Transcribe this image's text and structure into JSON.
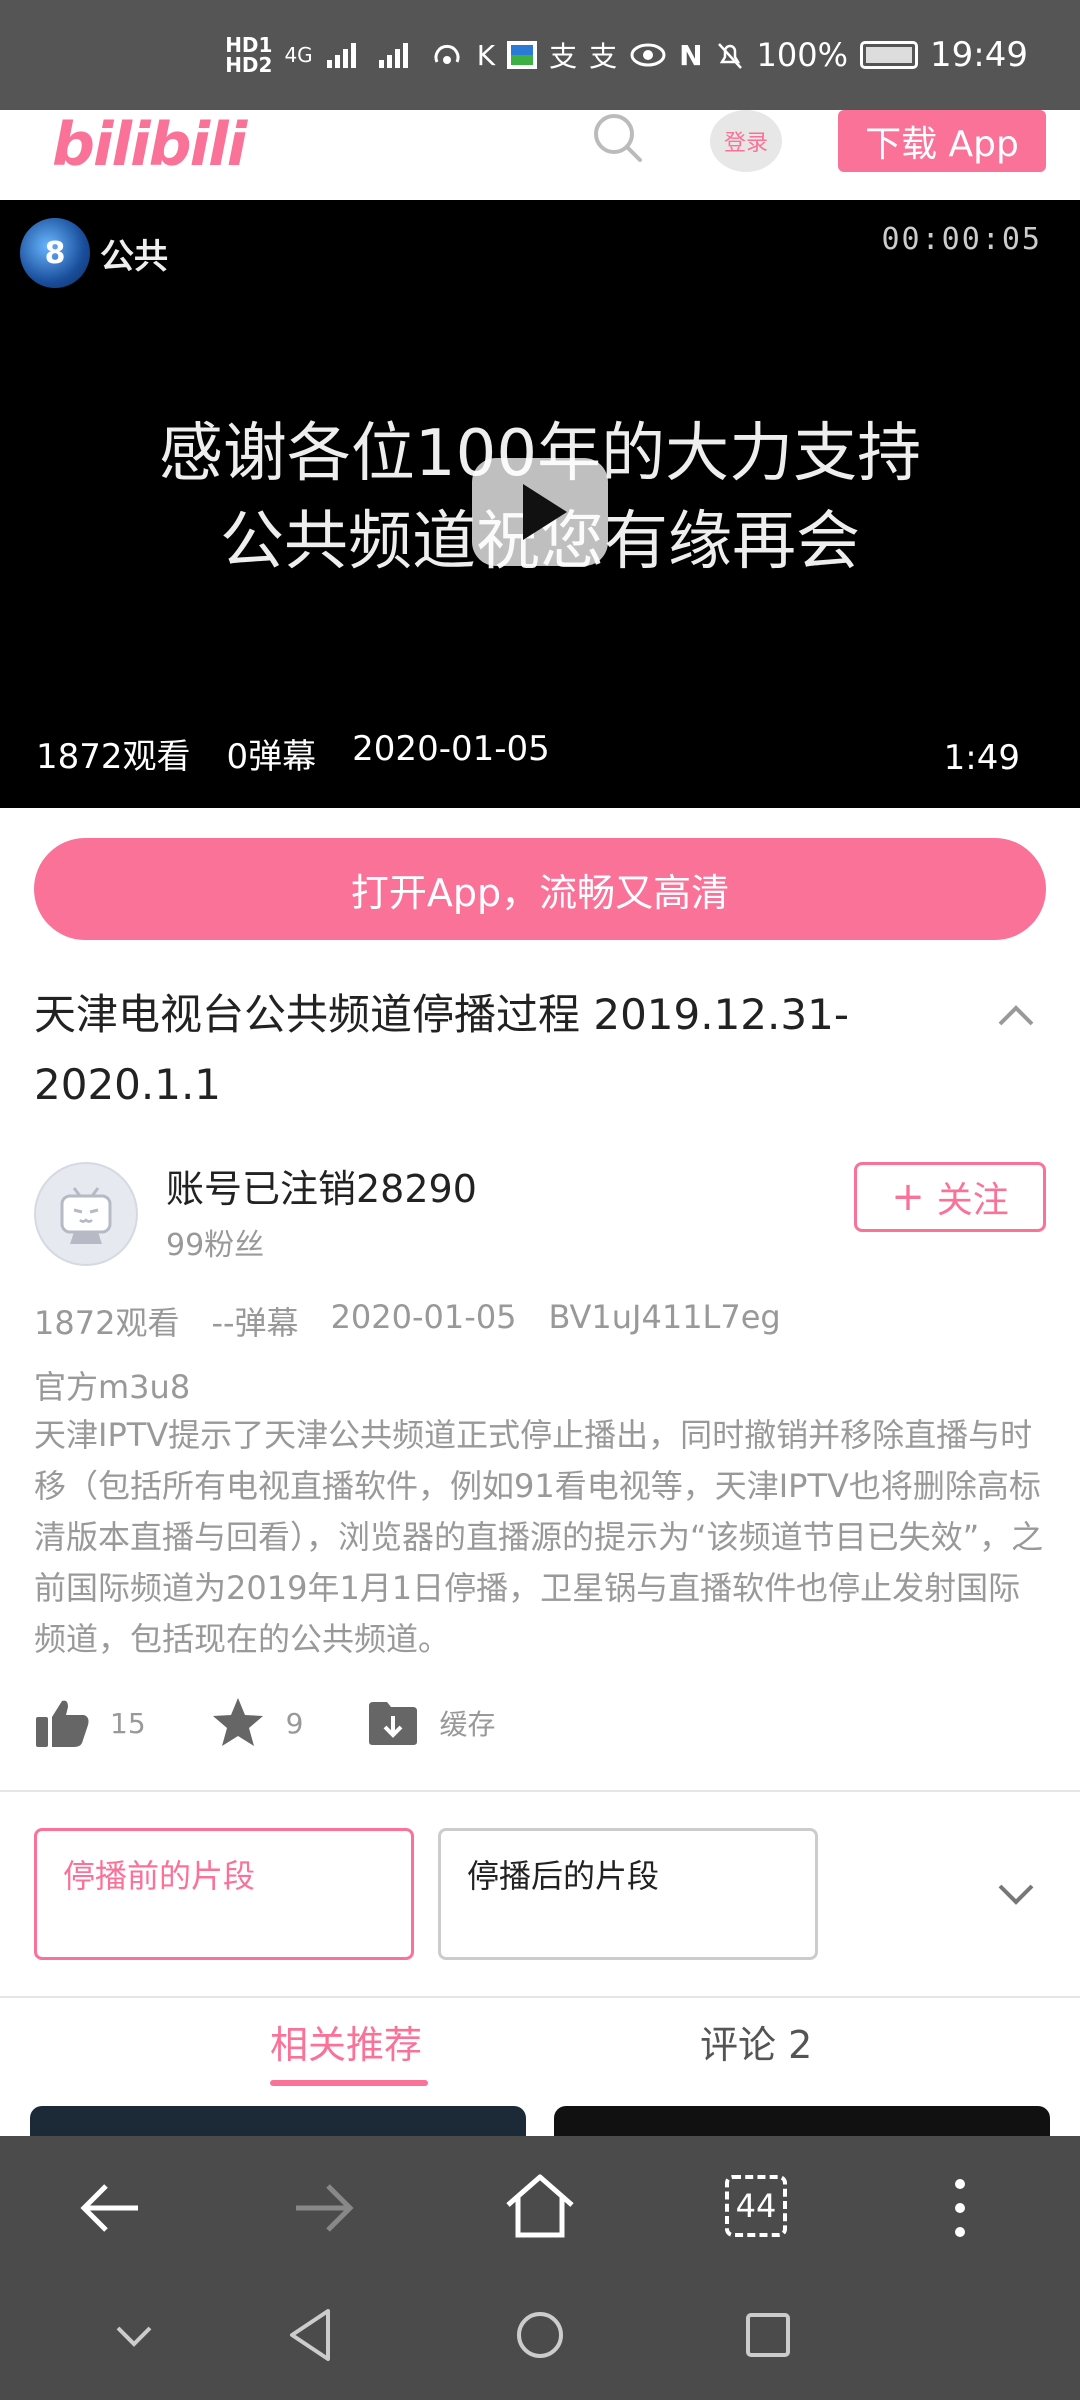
{
  "status_bar": {
    "hd1": "HD1",
    "hd2": "HD2",
    "net": "4G",
    "battery_pct": "100%",
    "time": "19:49"
  },
  "header": {
    "logo_text": "bilibili",
    "login_label": "登录",
    "download_label": "下载 App"
  },
  "video": {
    "channel_number": "8",
    "channel_name": "公共",
    "timecode": "00:00:05",
    "caption_line1": "感谢各位100年的大力支持",
    "caption_line2": "公共频道祝您有缘再会",
    "views": "1872观看",
    "danmaku": "0弹幕",
    "date": "2020-01-05",
    "duration": "1:49"
  },
  "open_app_label": "打开App，流畅又高清",
  "title": "天津电视台公共频道停播过程 2019.12.31-2020.1.1",
  "author": {
    "name": "账号已注销28290",
    "fans": "99粉丝",
    "follow_label": "关注"
  },
  "meta": {
    "views": "1872观看",
    "danmaku": "--弹幕",
    "date": "2020-01-05",
    "bvid": "BV1uJ411L7eg"
  },
  "description": {
    "source": "官方m3u8",
    "text": "天津IPTV提示了天津公共频道正式停止播出，同时撤销并移除直播与时移（包括所有电视直播软件，例如91看电视等，天津IPTV也将删除高标清版本直播与回看），浏览器的直播源的提示为“该频道节目已失效”，之前国际频道为2019年1月1日停播，卫星锅与直播软件也停止发射国际频道，包括现在的公共频道。"
  },
  "actions": {
    "likes": "15",
    "favorites": "9",
    "cache_label": "缓存"
  },
  "parts": [
    {
      "label": "停播前的片段"
    },
    {
      "label": "停播后的片段"
    }
  ],
  "tabs": {
    "related": "相关推荐",
    "comments": "评论 2"
  },
  "browser": {
    "tab_count": "44"
  },
  "colors": {
    "accent": "#fb7299",
    "status_bar": "#555555",
    "browser_bar": "#4b4b4b"
  }
}
